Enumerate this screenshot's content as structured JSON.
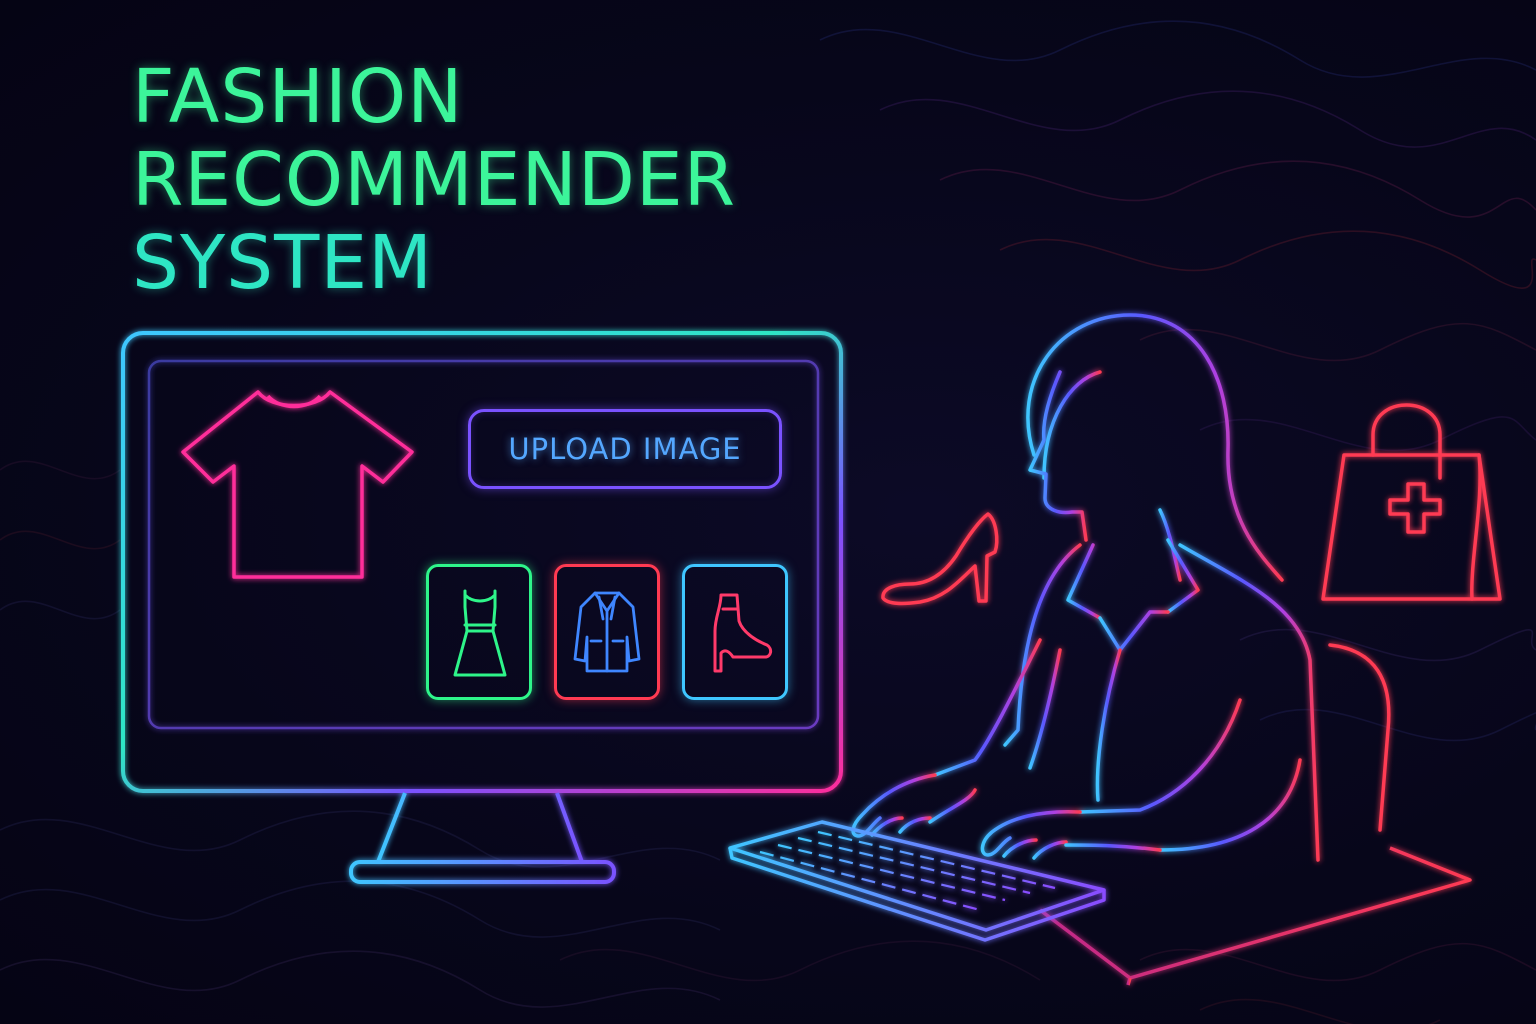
{
  "title": {
    "line1": "FASHION",
    "line2": "RECOMMENDER",
    "line3": "SYSTEM"
  },
  "screen": {
    "upload_label": "UPLOAD IMAGE",
    "uploaded_item_icon": "t-shirt-icon",
    "recommendations": [
      {
        "icon": "dress-icon",
        "border_color": "#2ef58a"
      },
      {
        "icon": "jacket-icon",
        "border_color": "#ff3a52"
      },
      {
        "icon": "ankle-boot-icon",
        "border_color": "#3fc6ff"
      }
    ]
  },
  "decorations": [
    "high-heel-shoe-icon",
    "shopping-bag-icon",
    "woman-at-keyboard-illustration"
  ],
  "colors": {
    "background": "#07061a",
    "title_green": "#3cf59a",
    "title_teal": "#2ee6c4",
    "neon_blue": "#3fc6ff",
    "neon_violet": "#7a52ff",
    "neon_pink": "#ff2d9a",
    "neon_red": "#ff3a52"
  }
}
